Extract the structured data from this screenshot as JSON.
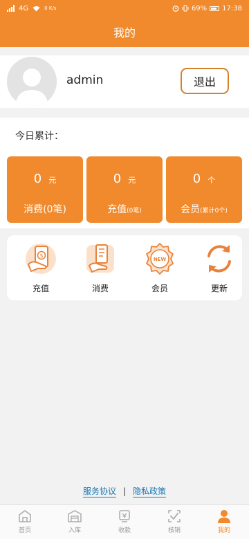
{
  "status_bar": {
    "network": "4G",
    "speed": "0 K/s",
    "battery": "69%",
    "time": "17:38"
  },
  "header": {
    "title": "我的"
  },
  "profile": {
    "username": "admin",
    "logout_label": "退出"
  },
  "stats": {
    "title": "今日累计：",
    "cards": [
      {
        "value": "0",
        "unit": "元",
        "label": "消费(0笔)",
        "note": ""
      },
      {
        "value": "0",
        "unit": "元",
        "label": "充值",
        "note": "(0笔)"
      },
      {
        "value": "0",
        "unit": "个",
        "label": "会员",
        "note": "(累计0个)"
      }
    ]
  },
  "functions": [
    {
      "label": "充值",
      "icon": "recharge-icon"
    },
    {
      "label": "消费",
      "icon": "consume-icon"
    },
    {
      "label": "会员",
      "icon": "member-icon"
    },
    {
      "label": "更新",
      "icon": "refresh-icon"
    }
  ],
  "footer": {
    "service_agreement": "服务协议",
    "separator": "|",
    "privacy_policy": "隐私政策"
  },
  "tabs": [
    {
      "label": "首页",
      "icon": "home-icon",
      "active": false
    },
    {
      "label": "入库",
      "icon": "warehouse-icon",
      "active": false
    },
    {
      "label": "收款",
      "icon": "payment-icon",
      "active": false
    },
    {
      "label": "核销",
      "icon": "verify-icon",
      "active": false
    },
    {
      "label": "我的",
      "icon": "user-icon",
      "active": true
    }
  ],
  "colors": {
    "accent": "#f08a2c",
    "link": "#1b78b5",
    "background": "#f2f2f2"
  }
}
